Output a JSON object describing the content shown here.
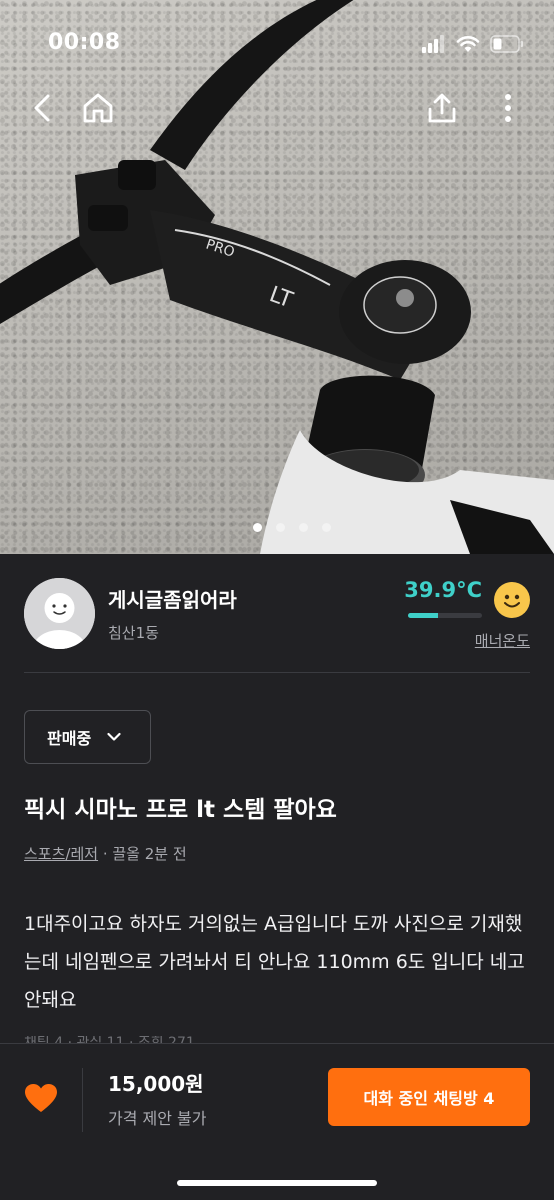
{
  "status_bar": {
    "time": "00:08"
  },
  "photo": {
    "description_icon": "bicycle-stem-photo",
    "page_count": 4,
    "current_page": 1
  },
  "seller": {
    "name": "게시글좀읽어라",
    "location": "침산1동",
    "temperature": "39.9°C",
    "temperature_fill": 0.4,
    "manner_label": "매너온도"
  },
  "post": {
    "status_label": "판매중",
    "title": "픽시 시마노 프로 lt 스템 팔아요",
    "category": "스포츠/레저",
    "time_ago": " · 끌올 2분 전",
    "description": "1대주이고요 하자도 거의없는 A급입니다 도까 사진으로 기재했는데 네임펜으로 가려놔서 티 안나요 110mm 6도 입니다 네고 안돼요"
  },
  "bottom_bar": {
    "price": "15,000원",
    "price_note": "가격 제안 불가",
    "chat_button": "대화 중인 채팅방 4"
  },
  "colors": {
    "accent": "#ff6f0f",
    "temperature": "#3fd0c9",
    "background": "#212124"
  }
}
